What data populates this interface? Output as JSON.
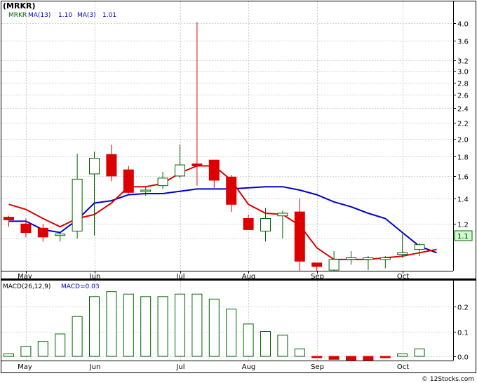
{
  "title": "(MRKR)",
  "watermark": "© 12Stocks.com",
  "colors": {
    "up": "#006400",
    "down": "#dd0000",
    "ma13": "#0000cc",
    "ma3": "#dd0000",
    "macd": "#006400",
    "grid": "#aaaaaa",
    "last_price_box": "#ccffcc"
  },
  "chart_data": [
    {
      "type": "candlestick",
      "title": "(MRKR)",
      "legend": [
        {
          "label": "MRKR",
          "color": "#006400"
        },
        {
          "label": "MA(13)",
          "color": "#0000cc"
        },
        {
          "label": "1.10",
          "color": "#0000cc"
        },
        {
          "label": "MA(3)",
          "color": "#0000cc"
        },
        {
          "label": "1.01",
          "color": "#0000cc"
        }
      ],
      "y_scale": "log",
      "ylim": [
        0.9,
        4.3
      ],
      "y_ticks": [
        "4.0",
        "3.6",
        "3.2",
        "3.0",
        "2.8",
        "2.6",
        "2.4",
        "2.2",
        "2.0",
        "1.8",
        "1.6",
        "1.4",
        "1.2",
        "1.1"
      ],
      "last_price_label": "1.1",
      "x_labels": [
        "May",
        "Jun",
        "Jul",
        "Aug",
        "Sep",
        "Oct"
      ],
      "candles": [
        {
          "o": 1.25,
          "h": 1.26,
          "l": 1.18,
          "c": 1.23
        },
        {
          "o": 1.2,
          "h": 1.24,
          "l": 1.11,
          "c": 1.14
        },
        {
          "o": 1.17,
          "h": 1.2,
          "l": 1.08,
          "c": 1.11
        },
        {
          "o": 1.12,
          "h": 1.14,
          "l": 1.08,
          "c": 1.13
        },
        {
          "o": 1.15,
          "h": 1.83,
          "l": 1.1,
          "c": 1.57
        },
        {
          "o": 1.62,
          "h": 1.85,
          "l": 1.12,
          "c": 1.78
        },
        {
          "o": 1.82,
          "h": 1.93,
          "l": 1.55,
          "c": 1.6
        },
        {
          "o": 1.66,
          "h": 1.7,
          "l": 1.44,
          "c": 1.45
        },
        {
          "o": 1.46,
          "h": 1.5,
          "l": 1.42,
          "c": 1.47
        },
        {
          "o": 1.51,
          "h": 1.64,
          "l": 1.48,
          "c": 1.58
        },
        {
          "o": 1.6,
          "h": 1.93,
          "l": 1.58,
          "c": 1.71
        },
        {
          "o": 1.72,
          "h": 4.03,
          "l": 1.51,
          "c": 1.7
        },
        {
          "o": 1.76,
          "h": 1.76,
          "l": 1.49,
          "c": 1.56
        },
        {
          "o": 1.59,
          "h": 1.61,
          "l": 1.29,
          "c": 1.35
        },
        {
          "o": 1.24,
          "h": 1.27,
          "l": 1.16,
          "c": 1.16
        },
        {
          "o": 1.15,
          "h": 1.32,
          "l": 1.08,
          "c": 1.24
        },
        {
          "o": 1.26,
          "h": 1.3,
          "l": 1.1,
          "c": 1.28
        },
        {
          "o": 1.29,
          "h": 1.4,
          "l": 0.9,
          "c": 0.96
        },
        {
          "o": 0.95,
          "h": 0.95,
          "l": 0.88,
          "c": 0.93
        },
        {
          "o": 0.91,
          "h": 1.02,
          "l": 0.88,
          "c": 0.97
        },
        {
          "o": 0.97,
          "h": 1.02,
          "l": 0.94,
          "c": 0.98
        },
        {
          "o": 0.97,
          "h": 0.99,
          "l": 0.91,
          "c": 0.98
        },
        {
          "o": 0.97,
          "h": 0.99,
          "l": 0.92,
          "c": 0.98
        },
        {
          "o": 1.0,
          "h": 1.13,
          "l": 0.98,
          "c": 1.01
        },
        {
          "o": 1.03,
          "h": 1.07,
          "l": 0.99,
          "c": 1.06
        }
      ],
      "ma13": [
        1.22,
        1.22,
        1.16,
        1.14,
        1.23,
        1.36,
        1.38,
        1.43,
        1.44,
        1.44,
        1.46,
        1.48,
        1.48,
        1.48,
        1.49,
        1.5,
        1.5,
        1.47,
        1.43,
        1.37,
        1.33,
        1.28,
        1.24,
        1.14,
        1.05,
        1.01
      ],
      "ma3": [
        1.35,
        1.31,
        1.24,
        1.18,
        1.24,
        1.27,
        1.36,
        1.5,
        1.5,
        1.53,
        1.63,
        1.7,
        1.7,
        1.56,
        1.35,
        1.28,
        1.27,
        1.19,
        1.04,
        0.97,
        0.97,
        0.97,
        0.98,
        0.99,
        1.01,
        1.03
      ]
    },
    {
      "type": "bar",
      "title": "MACD(26,12,9)",
      "legend": [
        {
          "label": "MACD(26,12,9)",
          "color": "#000000"
        },
        {
          "label": "MACD=0.03",
          "color": "#0000cc"
        }
      ],
      "ylim": [
        -0.03,
        0.27
      ],
      "y_ticks": [
        "0.2",
        "0.1",
        "0.0"
      ],
      "x_labels": [
        "May",
        "Jun",
        "Jul",
        "Aug",
        "Sep",
        "Oct"
      ],
      "values": [
        0.01,
        0.04,
        0.06,
        0.09,
        0.16,
        0.24,
        0.26,
        0.25,
        0.24,
        0.24,
        0.25,
        0.25,
        0.23,
        0.19,
        0.13,
        0.1,
        0.085,
        0.03,
        -0.005,
        -0.012,
        -0.015,
        -0.015,
        -0.005,
        0.01,
        0.03
      ]
    }
  ]
}
